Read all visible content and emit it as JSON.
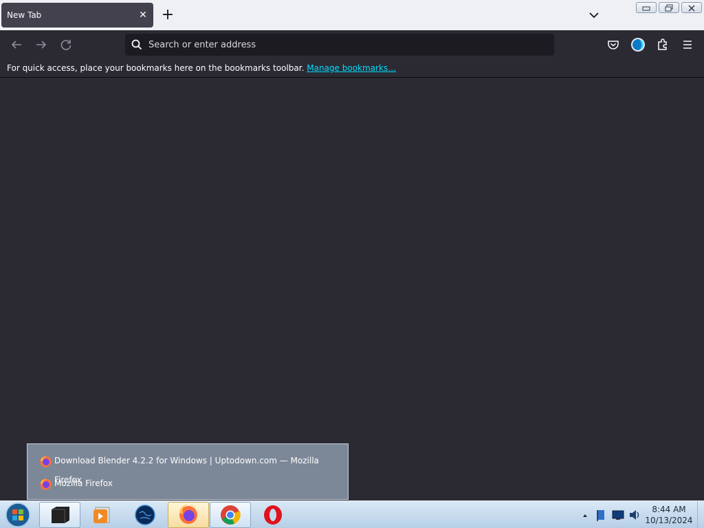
{
  "browser": {
    "tab": {
      "title": "New Tab",
      "close_symbol": "✕"
    },
    "new_tab_symbol": "+",
    "urlbar": {
      "placeholder": "Search or enter address"
    },
    "bookmarks_bar": {
      "message": "For quick access, place your bookmarks here on the bookmarks toolbar.",
      "link": "Manage bookmarks…"
    },
    "icons": [
      "back-icon",
      "forward-icon",
      "reload-icon",
      "pocket-icon",
      "account-icon",
      "extensions-icon",
      "menu-icon",
      "list-all-tabs-icon"
    ]
  },
  "taskbar_popup": {
    "items": [
      {
        "label": "Download Blender 4.2.2 for Windows | Uptodown.com — Mozilla Firefox"
      },
      {
        "label": "Mozilla Firefox"
      }
    ]
  },
  "taskbar": {
    "pinned": [
      "start-orb-icon",
      "terminal-icon",
      "media-player-icon",
      "globe-icon",
      "firefox-icon",
      "chrome-icon",
      "opera-icon"
    ],
    "tray_icons": [
      "show-hidden-icons-icon",
      "network-flag-icon",
      "monitor-icon",
      "speaker-icon"
    ],
    "clock": {
      "time": "8:44 AM",
      "date": "10/13/2024"
    }
  },
  "colors": {
    "toolbar": "#2b2a33",
    "tab_active": "#42414d",
    "urlbar": "#1c1b22",
    "link": "#00ddff",
    "popup": "#7c8898",
    "taskbar": "#c7dcef"
  }
}
